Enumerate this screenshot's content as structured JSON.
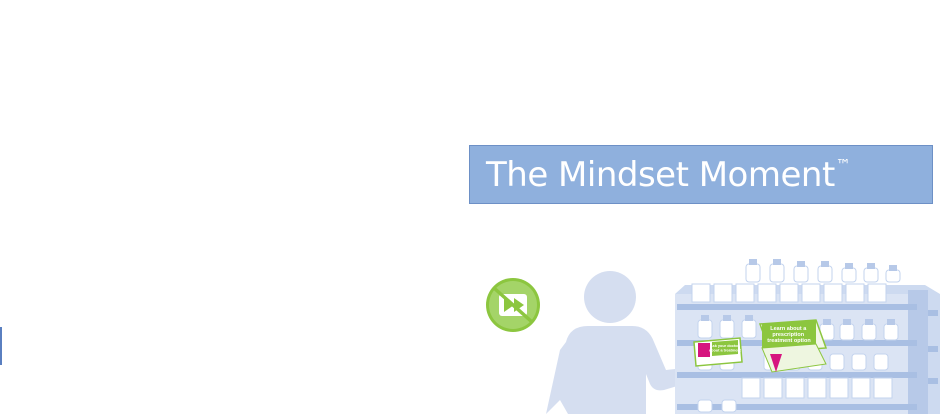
{
  "banner": {
    "title": "The Mindset Moment",
    "trademark": "™"
  },
  "scene": {
    "no_skip_icon": "fast-forward-prohibited-icon",
    "large_pack_text": "Learn about a prescription treatment option",
    "small_pack_text": "Ask your doctor about a treatment"
  },
  "colors": {
    "banner_fill": "#8fb0dd",
    "person": "#d5def0",
    "shelf": "#bfd0ec",
    "icon_green": "#8cc63f",
    "pack_green": "#8cc63f",
    "pack_magenta": "#d6157f"
  }
}
